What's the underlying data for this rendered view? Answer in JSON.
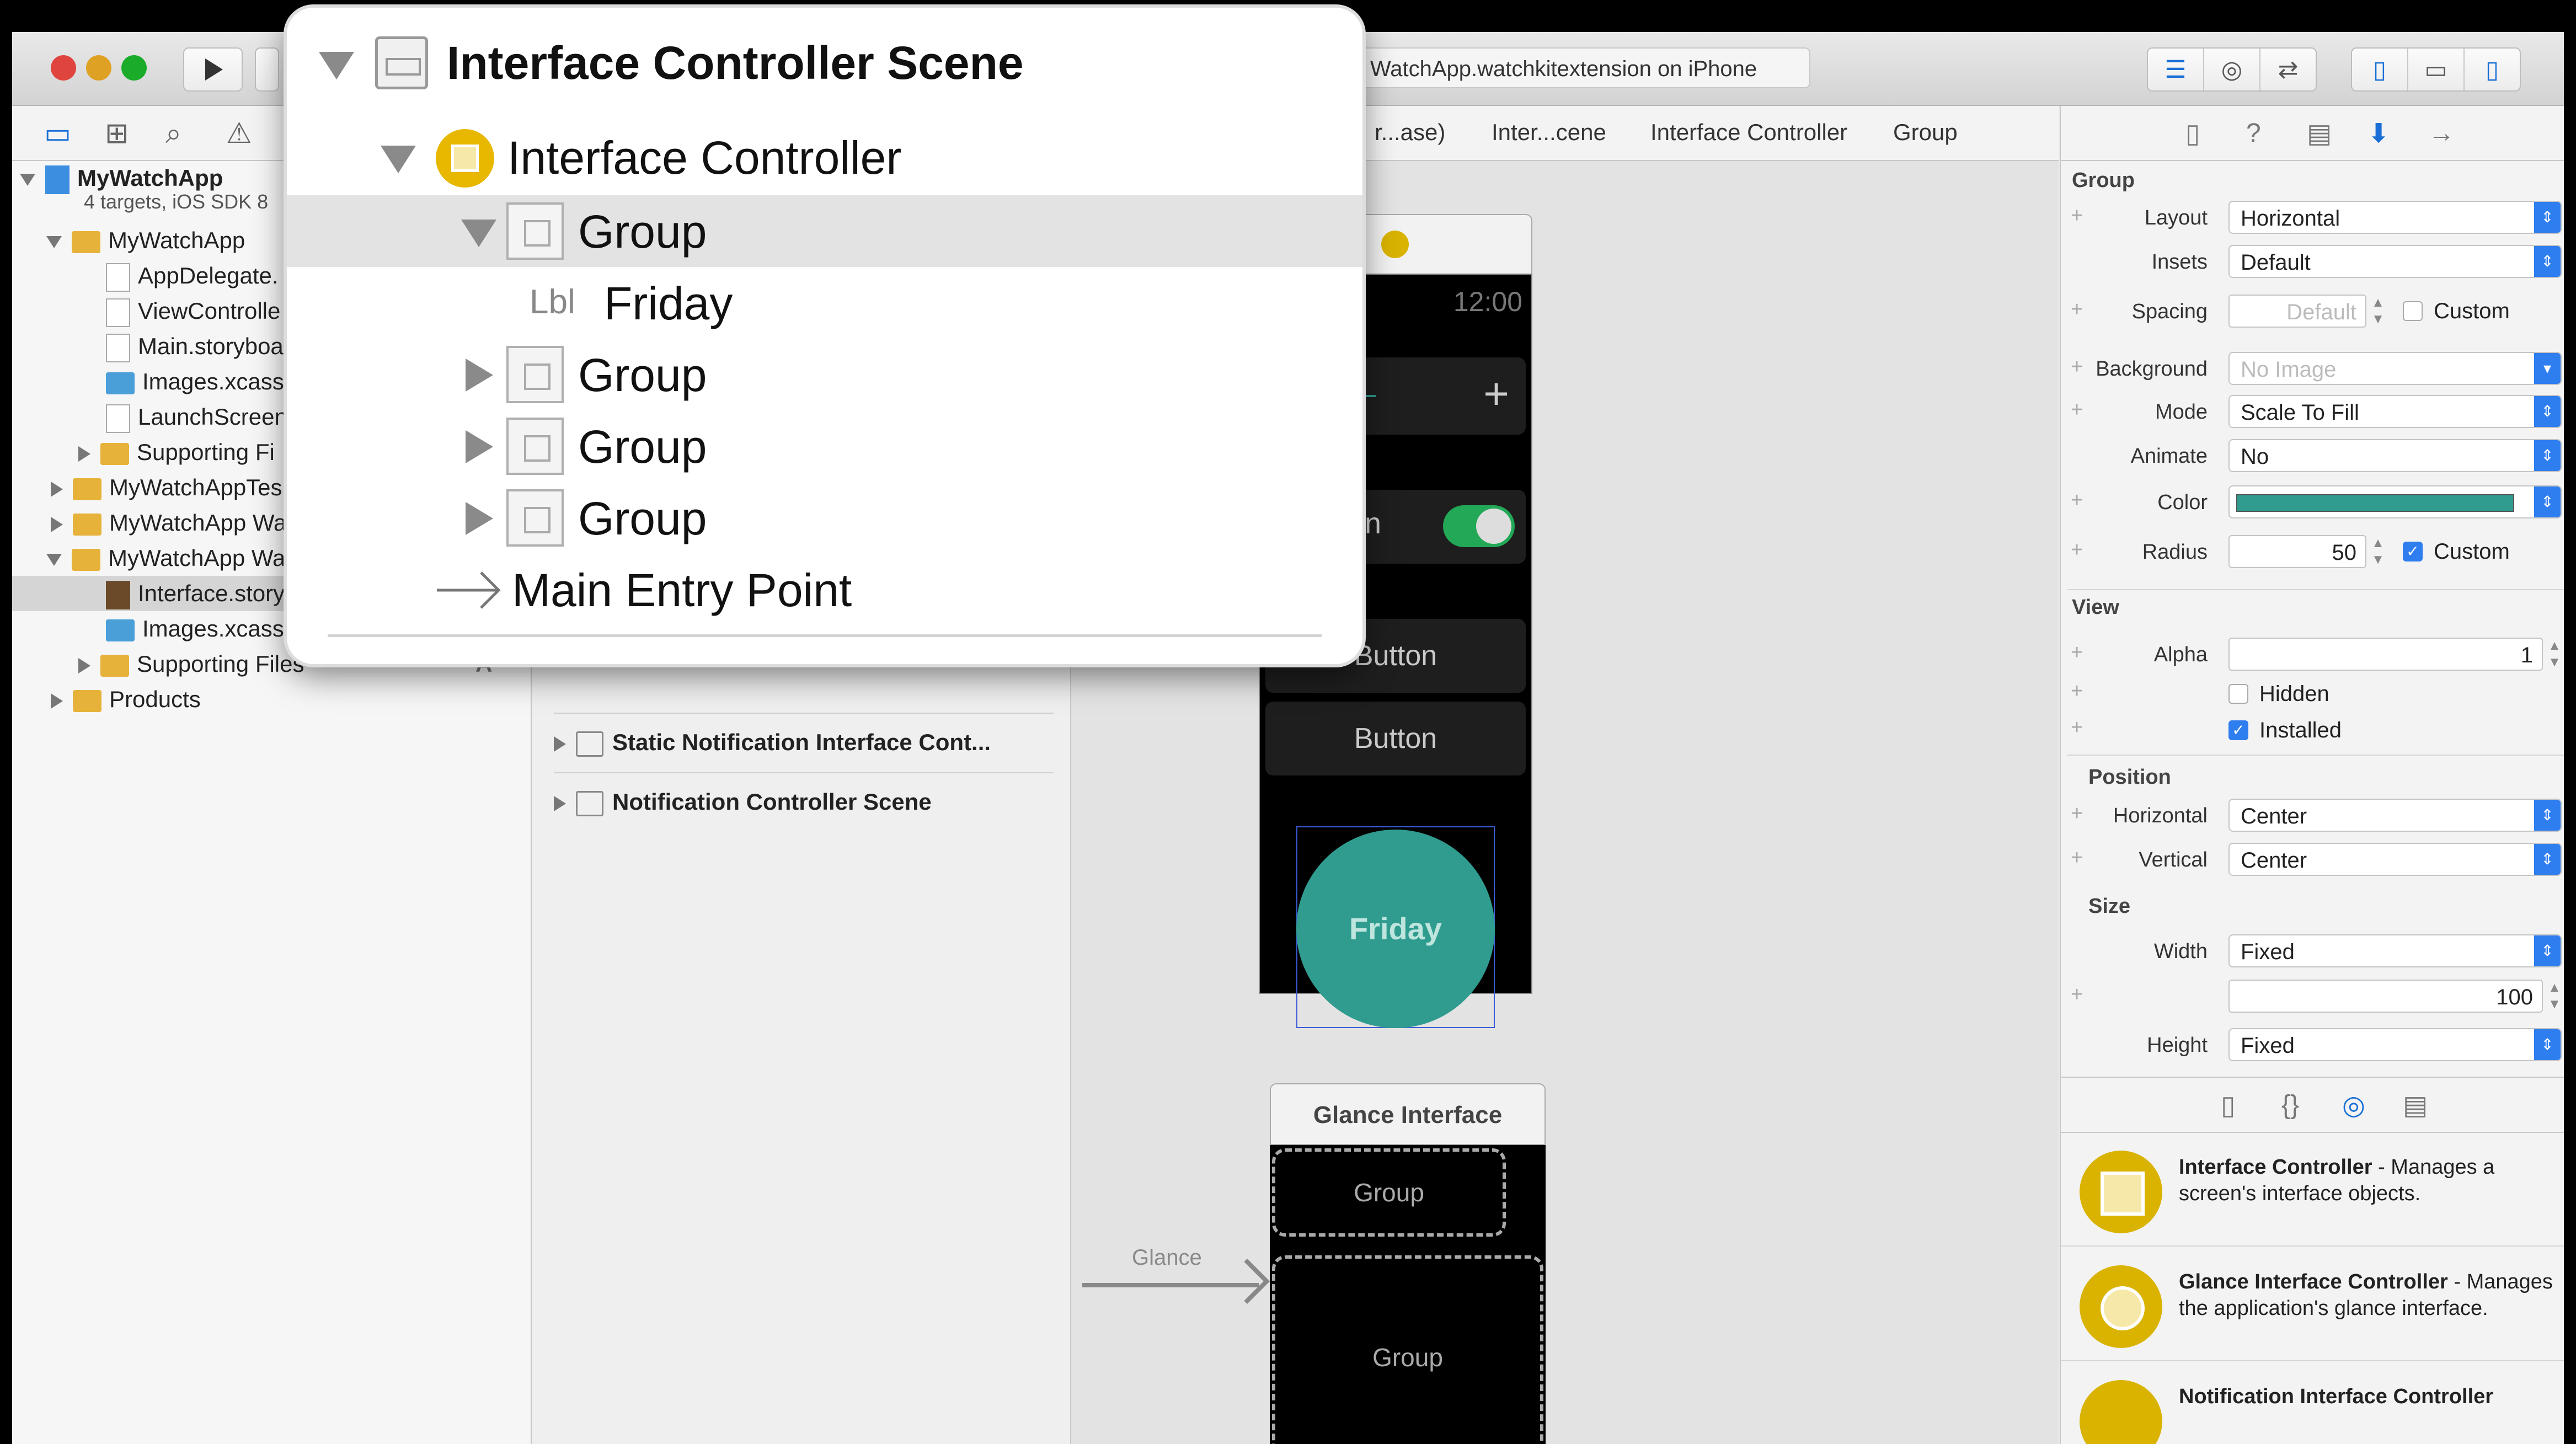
{
  "toolbar": {
    "activity_text": "WatchApp.watchkitextension on iPhone"
  },
  "jumpbar": {
    "crumbs": [
      "r...ase)",
      "Inter...cene",
      "Interface Controller",
      "Group"
    ]
  },
  "navigator": {
    "project_name": "MyWatchApp",
    "project_subtitle": "4 targets, iOS SDK 8",
    "items": [
      "MyWatchApp",
      "AppDelegate.",
      "ViewControlle",
      "Main.storyboa",
      "Images.xcass",
      "LaunchScreen",
      "Supporting Fi",
      "MyWatchAppTes",
      "MyWatchApp Wa",
      "MyWatchApp Wa",
      "Interface.story",
      "Images.xcasse",
      "Supporting Files",
      "Products"
    ],
    "badge": "A"
  },
  "outline": {
    "rows": [
      "Static Notification Interface Cont...",
      "Notification Controller Scene"
    ]
  },
  "canvas": {
    "watch_time": "12:00",
    "plus": "+",
    "partial_label": "n",
    "button1": "Button",
    "button2": "Button",
    "circle_label": "Friday",
    "glance_title": "Glance Interface",
    "glance_group1": "Group",
    "glance_group2": "Group",
    "glance_segue": "Glance"
  },
  "inspector": {
    "group_header": "Group",
    "layout_label": "Layout",
    "layout_value": "Horizontal",
    "insets_label": "Insets",
    "insets_value": "Default",
    "spacing_label": "Spacing",
    "spacing_value": "Default",
    "spacing_custom": "Custom",
    "background_label": "Background",
    "background_value": "No Image",
    "mode_label": "Mode",
    "mode_value": "Scale To Fill",
    "animate_label": "Animate",
    "animate_value": "No",
    "color_label": "Color",
    "color_value": "#2f9c8f",
    "radius_label": "Radius",
    "radius_value": "50",
    "radius_custom": "Custom",
    "view_header": "View",
    "alpha_label": "Alpha",
    "alpha_value": "1",
    "hidden_label": "Hidden",
    "installed_label": "Installed",
    "position_header": "Position",
    "horizontal_label": "Horizontal",
    "horizontal_value": "Center",
    "vertical_label": "Vertical",
    "vertical_value": "Center",
    "size_header": "Size",
    "width_label": "Width",
    "width_value": "Fixed",
    "width_number": "100",
    "height_label": "Height",
    "height_value": "Fixed"
  },
  "library": {
    "items": [
      {
        "title": "Interface Controller",
        "desc": " - Manages a screen's interface objects."
      },
      {
        "title": "Glance Interface Controller",
        "desc": " - Manages the application's glance interface."
      },
      {
        "title": "Notification Interface Controller",
        "desc": ""
      }
    ]
  },
  "zoom": {
    "scene_title": "Interface Controller Scene",
    "controller": "Interface Controller",
    "group_selected": "Group",
    "label_prefix": "Lbl",
    "label_text": "Friday",
    "group2": "Group",
    "group3": "Group",
    "group4": "Group",
    "entry_point": "Main Entry Point"
  },
  "colors": {
    "accent": "#2f7ef0",
    "teal": "#2f9c8f",
    "controller_yellow": "#d9b300"
  }
}
